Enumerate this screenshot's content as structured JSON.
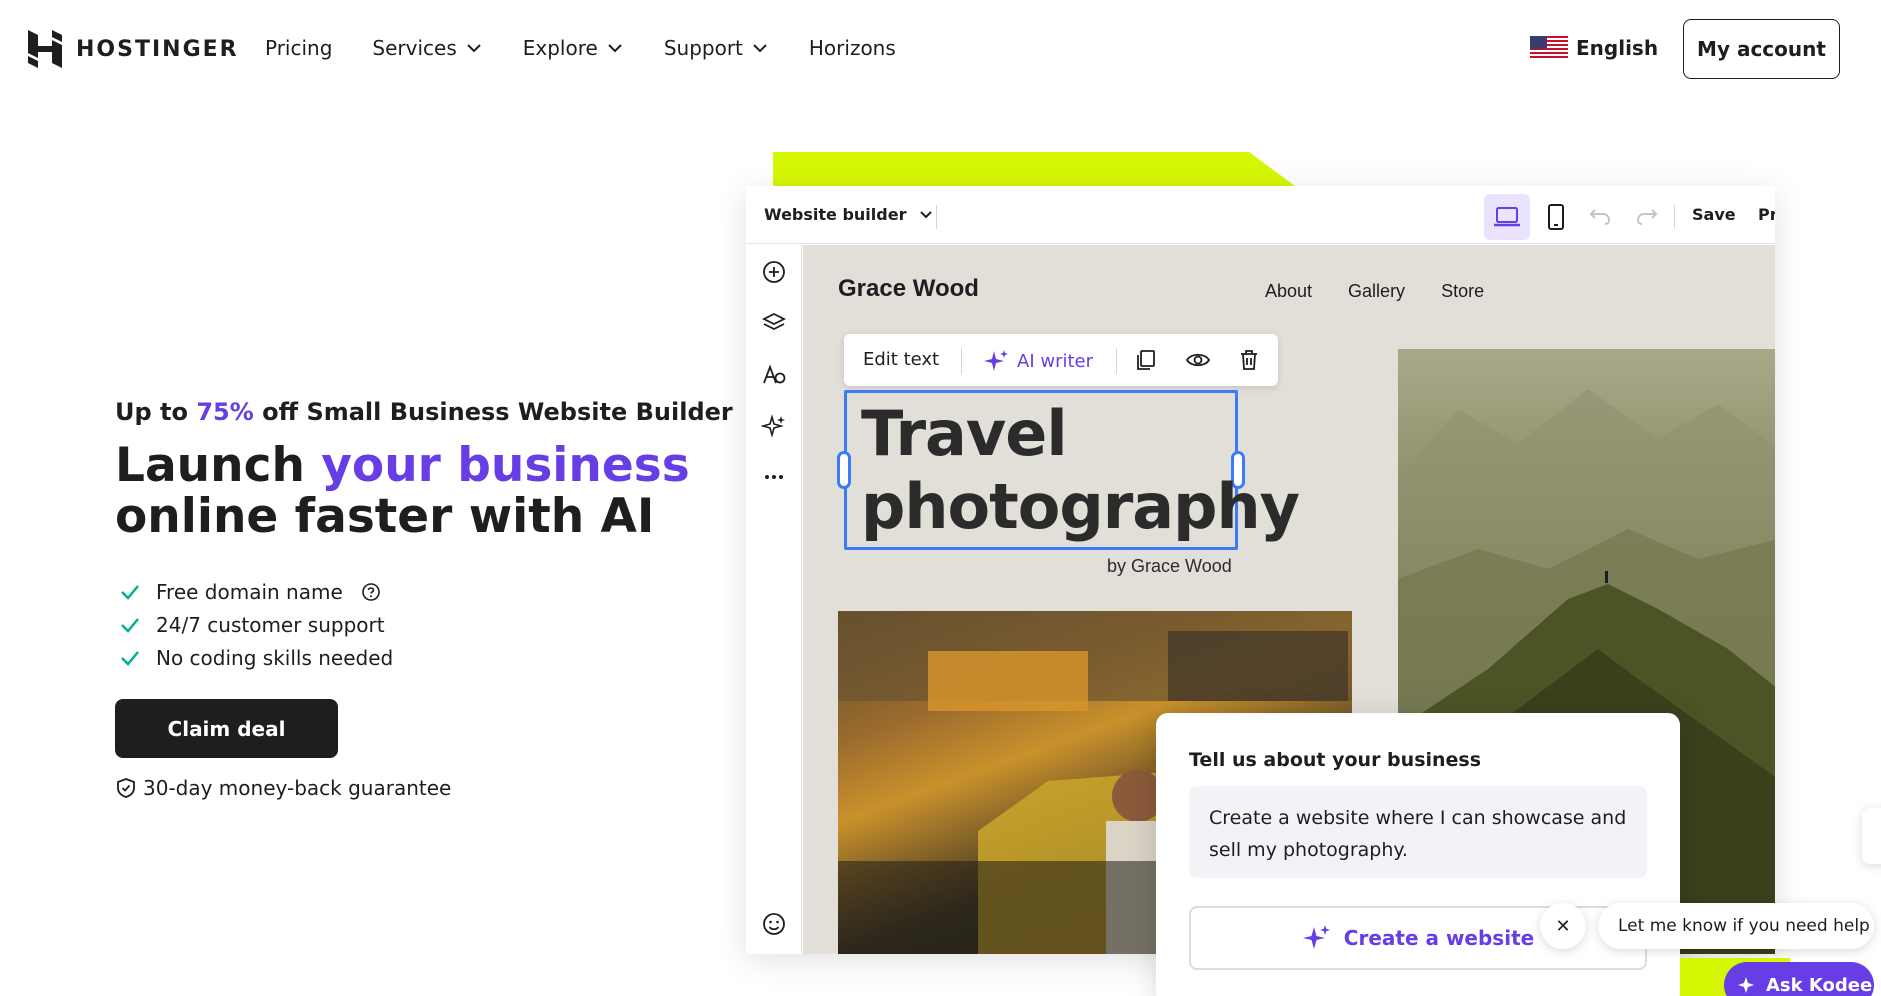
{
  "brand": {
    "name": "HOSTINGER"
  },
  "nav": {
    "items": [
      {
        "label": "Pricing",
        "dropdown": false
      },
      {
        "label": "Services",
        "dropdown": true
      },
      {
        "label": "Explore",
        "dropdown": true
      },
      {
        "label": "Support",
        "dropdown": true
      },
      {
        "label": "Horizons",
        "dropdown": false
      }
    ],
    "language": "English",
    "account_label": "My account"
  },
  "hero": {
    "subtitle_prefix": "Up to ",
    "subtitle_accent": "75%",
    "subtitle_suffix": " off Small Business Website Builder",
    "title_line1_prefix": "Launch ",
    "title_line1_accent": "your business",
    "title_line2": "online faster with AI",
    "features": [
      "Free domain name",
      "24/7 customer support",
      "No coding skills needed"
    ],
    "cta_label": "Claim deal",
    "guarantee": "30-day money-back guarantee"
  },
  "builder": {
    "selector_label": "Website builder",
    "save_label": "Save",
    "preview_label": "Pr",
    "site": {
      "name": "Grace Wood",
      "nav": [
        "About",
        "Gallery",
        "Store"
      ],
      "heading_line1": "Travel",
      "heading_line2": "photography",
      "byline": "by Grace Wood"
    },
    "toolbar": {
      "edit_label": "Edit text",
      "ai_label": "AI writer"
    }
  },
  "prompt_card": {
    "title": "Tell us about your business",
    "input_value": "Create a website where I can showcase and sell my photography.",
    "button_label": "Create a website"
  },
  "chat": {
    "message": "Let me know if you need help",
    "button_label": "Ask Kodee",
    "close_glyph": "✕"
  },
  "colors": {
    "accent": "#673de6",
    "lime": "#d6f704",
    "dark": "#1d1e20",
    "check": "#00b090",
    "selection": "#3a7bf6"
  }
}
